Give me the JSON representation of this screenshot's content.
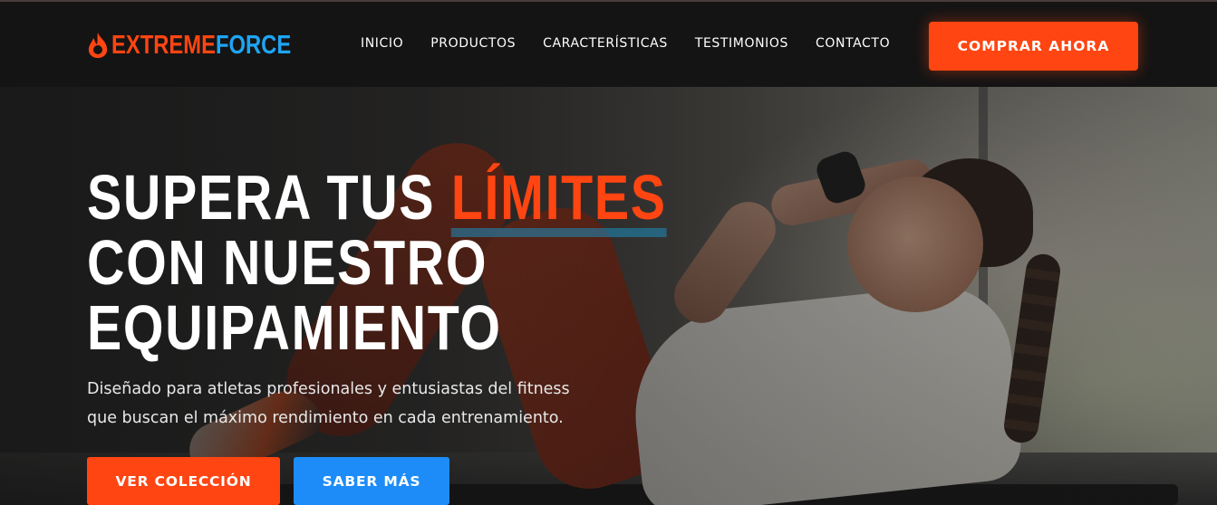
{
  "brand": {
    "name_part1": "EXTREME",
    "name_part2": "FORCE",
    "icon": "flame-icon",
    "colors": {
      "accent_orange": "#ff4512",
      "accent_blue": "#1ea5f4"
    }
  },
  "nav": {
    "items": [
      {
        "label": "INICIO"
      },
      {
        "label": "PRODUCTOS"
      },
      {
        "label": "CARACTERÍSTICAS"
      },
      {
        "label": "TESTIMONIOS"
      },
      {
        "label": "CONTACTO"
      }
    ],
    "buy_label": "COMPRAR AHORA"
  },
  "hero": {
    "headline_part1": "SUPERA TUS",
    "headline_accent": "LÍMITES",
    "headline_line2": "CON NUESTRO",
    "headline_line3": "EQUIPAMIENTO",
    "subtitle_line1": "Diseñado para atletas profesionales y entusiastas del fitness",
    "subtitle_line2": "que buscan el máximo rendimiento en cada entrenamiento.",
    "cta_primary": "VER COLECCIÓN",
    "cta_secondary": "SABER MÁS"
  }
}
